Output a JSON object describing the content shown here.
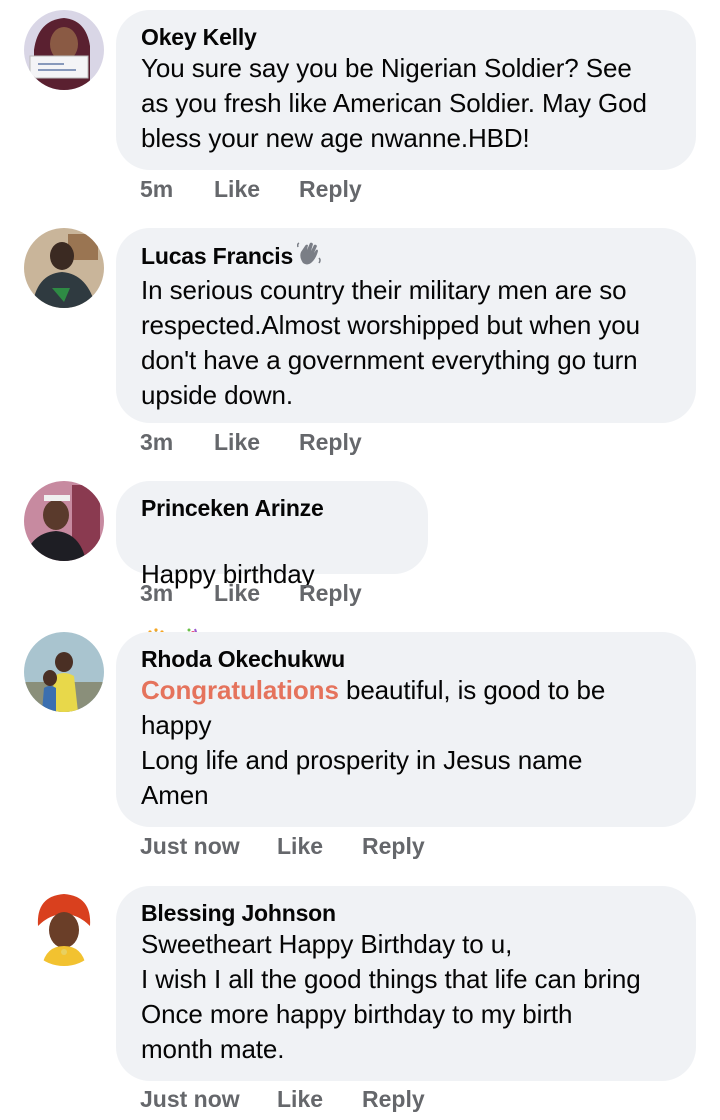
{
  "comments": [
    {
      "author": "Okey Kelly",
      "text": "You sure say you be Nigerian Soldier? See\nas you fresh like American Soldier. May God\nbless your new age nwanne.HBD!",
      "time": "5m",
      "like_label": "Like",
      "reply_label": "Reply"
    },
    {
      "author": "Lucas Francis",
      "badge_icon": "waving-hand-icon",
      "text": "In serious country their military men are so\nrespected.Almost worshipped but when you\ndon't have a government everything go turn\nupside down.",
      "time": "3m",
      "like_label": "Like",
      "reply_label": "Reply"
    },
    {
      "author": "Princeken Arinze",
      "text": "Happy birthday",
      "emojis": [
        "birthday-cake-icon",
        "party-popper-icon"
      ],
      "time": "3m",
      "like_label": "Like",
      "reply_label": "Reply"
    },
    {
      "author": "Rhoda Okechukwu",
      "highlight": "Congratulations",
      "text": " beautiful, is good to be\nhappy\nLong life and prosperity in Jesus name\nAmen",
      "time": "Just now",
      "like_label": "Like",
      "reply_label": "Reply"
    },
    {
      "author": "Blessing Johnson",
      "text": "Sweetheart Happy Birthday to u,\nI wish I all the good things that life can bring\nOnce more happy birthday to my birth\nmonth mate.",
      "time": "Just now",
      "like_label": "Like",
      "reply_label": "Reply"
    }
  ],
  "colors": {
    "bubble": "#f0f2f5",
    "meta_text": "#65676b",
    "highlight": "#e5735c"
  }
}
